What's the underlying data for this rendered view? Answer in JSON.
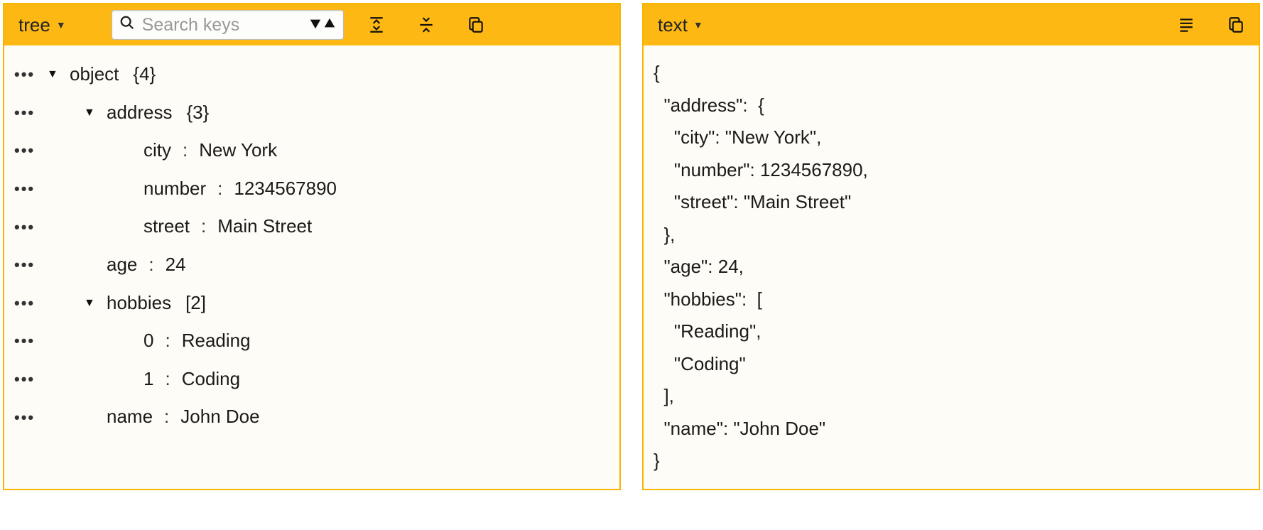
{
  "left_panel": {
    "mode_label": "tree",
    "search_placeholder": "Search keys",
    "tree": [
      {
        "depth": 0,
        "expandable": true,
        "key": "object",
        "suffix": "{4}"
      },
      {
        "depth": 1,
        "expandable": true,
        "key": "address",
        "suffix": "{3}"
      },
      {
        "depth": 2,
        "expandable": false,
        "key": "city",
        "value": "New York"
      },
      {
        "depth": 2,
        "expandable": false,
        "key": "number",
        "value": "1234567890"
      },
      {
        "depth": 2,
        "expandable": false,
        "key": "street",
        "value": "Main Street"
      },
      {
        "depth": 1,
        "expandable": false,
        "key": "age",
        "value": "24"
      },
      {
        "depth": 1,
        "expandable": true,
        "key": "hobbies",
        "suffix": "[2]"
      },
      {
        "depth": 2,
        "expandable": false,
        "key": "0",
        "value": "Reading"
      },
      {
        "depth": 2,
        "expandable": false,
        "key": "1",
        "value": "Coding"
      },
      {
        "depth": 1,
        "expandable": false,
        "key": "name",
        "value": "John Doe"
      }
    ]
  },
  "right_panel": {
    "mode_label": "text",
    "text_lines": [
      "{",
      "  \"address\":  {",
      "    \"city\": \"New York\",",
      "    \"number\": 1234567890,",
      "    \"street\": \"Main Street\"",
      "  },",
      "  \"age\": 24,",
      "  \"hobbies\":  [",
      "    \"Reading\",",
      "    \"Coding\"",
      "  ],",
      "  \"name\": \"John Doe\"",
      "}"
    ]
  }
}
